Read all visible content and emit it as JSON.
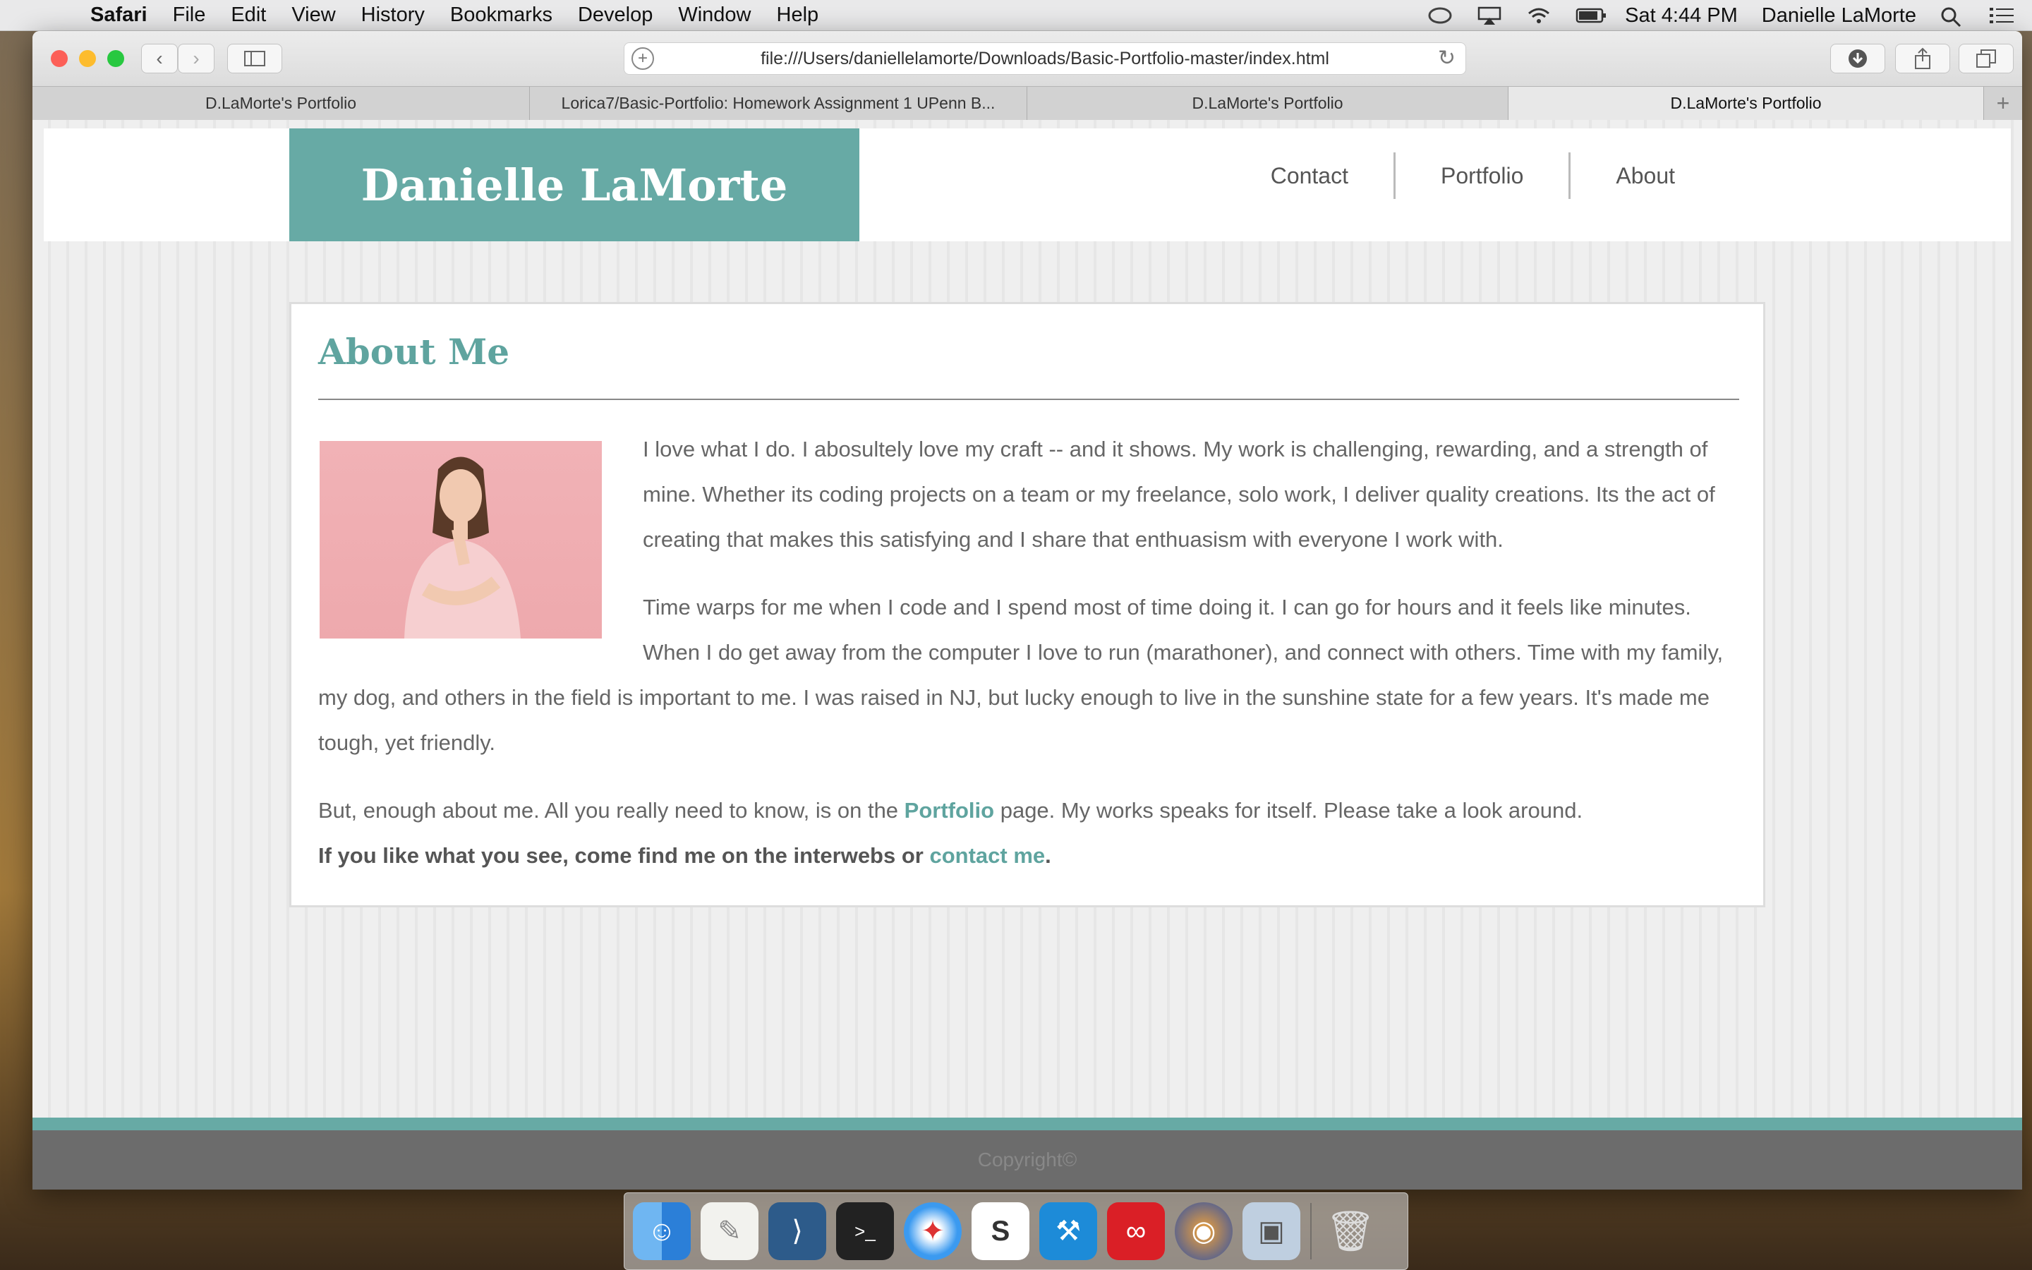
{
  "menubar": {
    "app": "Safari",
    "items": [
      "File",
      "Edit",
      "View",
      "History",
      "Bookmarks",
      "Develop",
      "Window",
      "Help"
    ],
    "clock": "Sat 4:44 PM",
    "user": "Danielle LaMorte"
  },
  "browser": {
    "url": "file:///Users/daniellelamorte/Downloads/Basic-Portfolio-master/index.html",
    "tabs": [
      {
        "title": "D.LaMorte's Portfolio"
      },
      {
        "title": "Lorica7/Basic-Portfolio: Homework Assignment 1 UPenn B..."
      },
      {
        "title": "D.LaMorte's Portfolio"
      },
      {
        "title": "D.LaMorte's Portfolio"
      }
    ],
    "new_tab": "+"
  },
  "site": {
    "brand": "Danielle LaMorte",
    "nav": [
      "Contact",
      "Portfolio",
      "About"
    ],
    "heading": "About Me",
    "p1": "I love what I do. I abosultely love my craft -- and it shows. My work is challenging, rewarding, and a strength of mine. Whether its coding projects on a team or my freelance, solo work, I deliver quality creations. Its the act of creating that makes this satisfying and I share that enthuasism with everyone I work with.",
    "p2": "Time warps for me when I code and I spend most of time doing it. I can go for hours and it feels like minutes. When I do get away from the computer I love to run (marathoner), and connect with others. Time with my family, my dog, and others in the field is important to me. I was raised in NJ, but lucky enough to live in the sunshine state for a few years. It's made me tough, yet friendly.",
    "p3_before": "But, enough about me. All you really need to know, is on the ",
    "p3_link": "Portfolio",
    "p3_after": " page. My works speaks for itself. Please take a look around.",
    "p4_before": "If you like what you see, come find me on the interwebs or ",
    "p4_link": "contact me",
    "p4_after": ".",
    "footer": "Copyright©"
  },
  "colors": {
    "accent": "#67aaa5",
    "link": "#5fa49f"
  }
}
